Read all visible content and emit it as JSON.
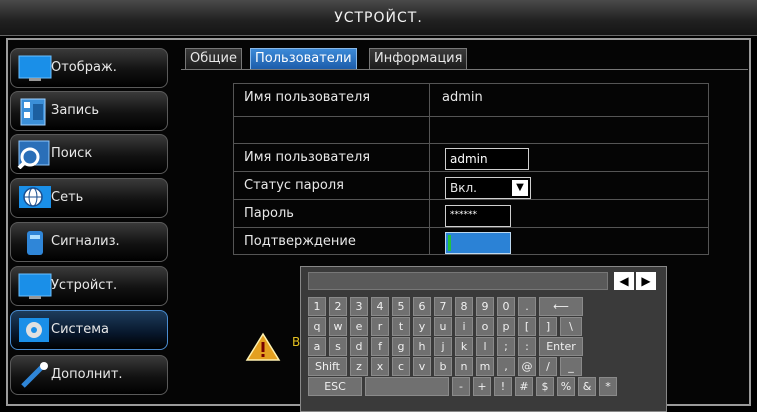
{
  "window": {
    "title": "УСТРОЙСТ."
  },
  "sidebar": {
    "items": [
      {
        "label": "Отображ.",
        "icon": "monitor-icon"
      },
      {
        "label": "Запись",
        "icon": "film-icon"
      },
      {
        "label": "Поиск",
        "icon": "magnifier-icon"
      },
      {
        "label": "Сеть",
        "icon": "globe-icon"
      },
      {
        "label": "Сигнализ.",
        "icon": "alarm-icon"
      },
      {
        "label": "Устройст.",
        "icon": "monitor-icon"
      },
      {
        "label": "Система",
        "icon": "gear-icon",
        "active": true
      },
      {
        "label": "Дополнит.",
        "icon": "wrench-icon"
      }
    ]
  },
  "tabs": [
    {
      "label": "Общие"
    },
    {
      "label": "Пользователи",
      "active": true
    },
    {
      "label": "Информация"
    }
  ],
  "form": {
    "header_label": "Имя пользователя",
    "header_value": "admin",
    "username_label": "Имя пользователя",
    "username_value": "admin",
    "password_status_label": "Статус пароля",
    "password_status_value": "Вкл.",
    "password_label": "Пароль",
    "password_value": "******",
    "confirm_label": "Подтверждение",
    "confirm_value": ""
  },
  "warning": {
    "text": "В"
  },
  "keyboard": {
    "rows": [
      [
        "1",
        "2",
        "3",
        "4",
        "5",
        "6",
        "7",
        "8",
        "9",
        "0",
        ".",
        "⟵"
      ],
      [
        "q",
        "w",
        "e",
        "r",
        "t",
        "y",
        "u",
        "i",
        "o",
        "p",
        "[",
        "]",
        "\\"
      ],
      [
        "a",
        "s",
        "d",
        "f",
        "g",
        "h",
        "j",
        "k",
        "l",
        ";",
        ":",
        "Enter"
      ],
      [
        "Shift",
        "z",
        "x",
        "c",
        "v",
        "b",
        "n",
        "m",
        ",",
        "@",
        "/",
        "_"
      ],
      [
        "ESC",
        "",
        "-",
        "+",
        "!",
        "#",
        "$",
        "%",
        "&",
        "*"
      ]
    ],
    "left_arrow": "◀",
    "right_arrow": "▶"
  },
  "colors": {
    "accent": "#2b7ad0",
    "confirm_fill": "#2b82d6",
    "confirm_cursor": "#23c23f",
    "warning": "#e4c020"
  }
}
